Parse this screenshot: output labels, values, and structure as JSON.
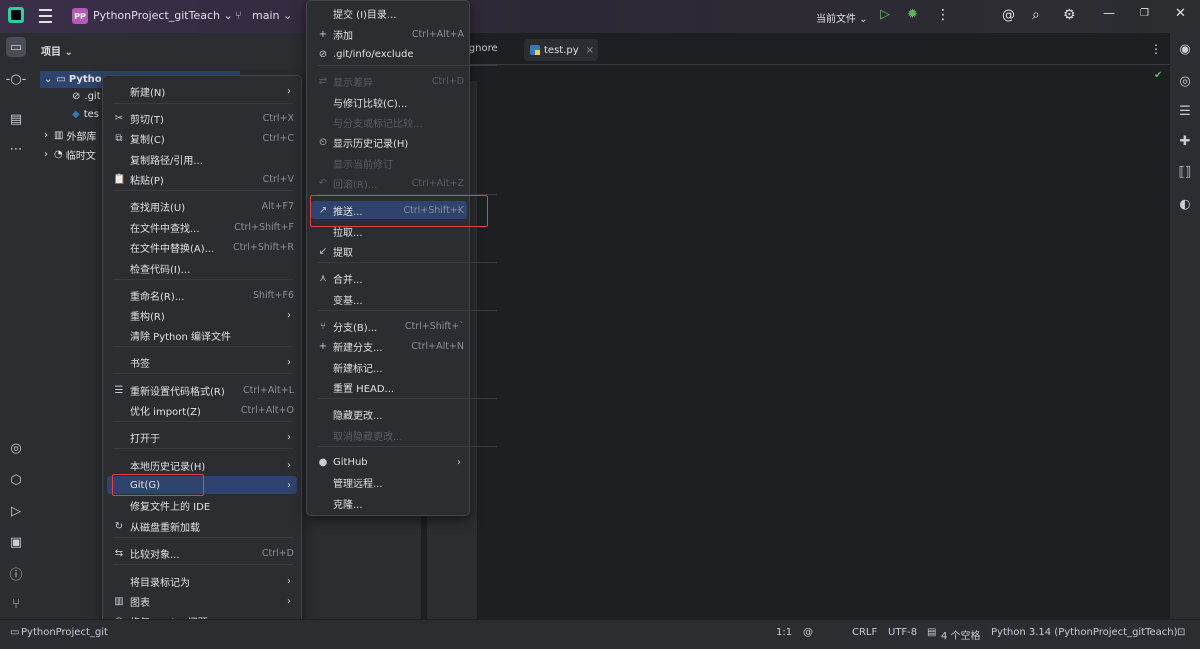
{
  "titlebar": {
    "project_badge": "PP",
    "project_name": "PythonProject_gitTeach ⌄",
    "branch": "main ⌄",
    "run_config": "当前文件 ⌄"
  },
  "project_panel": {
    "header": "项目 ⌄",
    "tree": {
      "root": "Pytho",
      "item1": ".git",
      "item2": "tes",
      "item3": "外部库",
      "item4": "临时文"
    }
  },
  "editor": {
    "tab_gitignore": "ignore",
    "tab_active": "test.py"
  },
  "context_menu": {
    "items": [
      {
        "label": "新建(N)",
        "shortcut": "",
        "arrow": true
      },
      {
        "label": "剪切(T)",
        "shortcut": "Ctrl+X"
      },
      {
        "label": "复制(C)",
        "shortcut": "Ctrl+C"
      },
      {
        "label": "复制路径/引用...",
        "shortcut": ""
      },
      {
        "label": "粘贴(P)",
        "shortcut": "Ctrl+V"
      },
      {
        "label": "查找用法(U)",
        "shortcut": "Alt+F7"
      },
      {
        "label": "在文件中查找...",
        "shortcut": "Ctrl+Shift+F"
      },
      {
        "label": "在文件中替换(A)...",
        "shortcut": "Ctrl+Shift+R"
      },
      {
        "label": "检查代码(I)...",
        "shortcut": ""
      },
      {
        "label": "重命名(R)...",
        "shortcut": "Shift+F6"
      },
      {
        "label": "重构(R)",
        "shortcut": "",
        "arrow": true
      },
      {
        "label": "清除 Python 编译文件",
        "shortcut": ""
      },
      {
        "label": "书签",
        "shortcut": "",
        "arrow": true
      },
      {
        "label": "重新设置代码格式(R)",
        "shortcut": "Ctrl+Alt+L"
      },
      {
        "label": "优化 import(Z)",
        "shortcut": "Ctrl+Alt+O"
      },
      {
        "label": "打开于",
        "shortcut": "",
        "arrow": true
      },
      {
        "label": "本地历史记录(H)",
        "shortcut": "",
        "arrow": true
      },
      {
        "label": "Git(G)",
        "shortcut": "",
        "arrow": true
      },
      {
        "label": "修复文件上的 IDE",
        "shortcut": ""
      },
      {
        "label": "从磁盘重新加载",
        "shortcut": ""
      },
      {
        "label": "比较对象...",
        "shortcut": "Ctrl+D"
      },
      {
        "label": "将目录标记为",
        "shortcut": "",
        "arrow": true
      },
      {
        "label": "图表",
        "shortcut": "",
        "arrow": true
      },
      {
        "label": "修复 ESLint 问题",
        "shortcut": ""
      }
    ]
  },
  "git_menu": {
    "items": [
      {
        "label": "提交 (I)目录...",
        "shortcut": ""
      },
      {
        "label": "添加",
        "shortcut": "Ctrl+Alt+A"
      },
      {
        "label": ".git/info/exclude",
        "shortcut": ""
      },
      {
        "label": "显示差异",
        "shortcut": "Ctrl+D"
      },
      {
        "label": "与修订比较(C)...",
        "shortcut": ""
      },
      {
        "label": "与分支或标记比较...",
        "shortcut": ""
      },
      {
        "label": "显示历史记录(H)",
        "shortcut": ""
      },
      {
        "label": "显示当前修订",
        "shortcut": ""
      },
      {
        "label": "回滚(R)...",
        "shortcut": "Ctrl+Alt+Z"
      },
      {
        "label": "推送...",
        "shortcut": "Ctrl+Shift+K"
      },
      {
        "label": "拉取...",
        "shortcut": ""
      },
      {
        "label": "提取",
        "shortcut": ""
      },
      {
        "label": "合并...",
        "shortcut": ""
      },
      {
        "label": "变基...",
        "shortcut": ""
      },
      {
        "label": "分支(B)...",
        "shortcut": "Ctrl+Shift+`"
      },
      {
        "label": "新建分支...",
        "shortcut": "Ctrl+Alt+N"
      },
      {
        "label": "新建标记...",
        "shortcut": ""
      },
      {
        "label": "重置 HEAD...",
        "shortcut": ""
      },
      {
        "label": "隐藏更改...",
        "shortcut": ""
      },
      {
        "label": "取消隐藏更改...",
        "shortcut": ""
      },
      {
        "label": "GitHub",
        "shortcut": "",
        "arrow": true
      },
      {
        "label": "管理远程...",
        "shortcut": ""
      },
      {
        "label": "克隆...",
        "shortcut": ""
      }
    ]
  },
  "statusbar": {
    "breadcrumb": "PythonProject_git",
    "position": "1:1",
    "line_ending": "CRLF",
    "encoding": "UTF-8",
    "indent": "4 个空格",
    "interpreter": "Python 3.14 (PythonProject_gitTeach)"
  },
  "colors": {
    "highlight": "#2e436e",
    "annotation_box": "#e34040",
    "run_green": "#5fb85c"
  }
}
